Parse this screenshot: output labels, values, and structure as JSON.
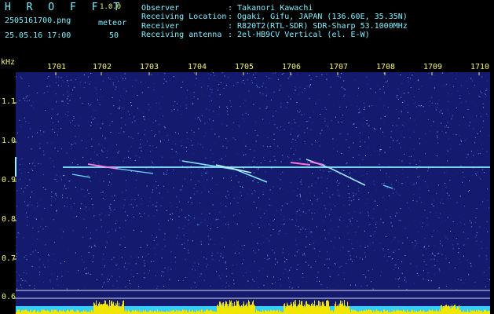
{
  "app": {
    "brand": "H R O F F T",
    "version": "1.0.0"
  },
  "file": {
    "name": "2505161700.png",
    "datetime": "25.05.16 17:00",
    "meteor_label": "meteor",
    "meteor_count": "50"
  },
  "info": [
    {
      "label": "Observer",
      "value": ": Takanori Kawachi"
    },
    {
      "label": "Receiving Location",
      "value": ": Ogaki, Gifu, JAPAN (136.60E, 35.35N)"
    },
    {
      "label": "Receiver",
      "value": ": R820T2(RTL-SDR) SDR-Sharp 53.1000MHz"
    },
    {
      "label": "Receiving antenna",
      "value": ": 2el-HB9CV Vertical (el. E-W)"
    }
  ],
  "axes": {
    "y_unit": "kHz",
    "x_ticks": [
      "1701",
      "1702",
      "1703",
      "1704",
      "1705",
      "1706",
      "1707",
      "1708",
      "1709",
      "1710"
    ],
    "y_ticks": [
      "1.1",
      "1.0",
      "0.9",
      "0.8",
      "0.7",
      "0.6"
    ]
  },
  "colors": {
    "background": "#000000",
    "waterfall": "#141a6e",
    "header_text": "#7ff0ff",
    "label_text": "#f4f27a",
    "activity_bar": "#f2e600",
    "carrier": "#8ff2ff"
  }
}
